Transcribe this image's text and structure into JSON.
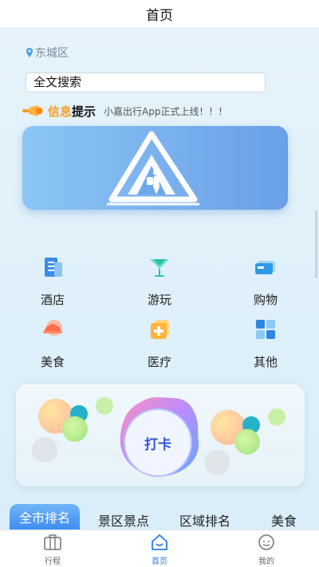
{
  "header": {
    "title": "首页"
  },
  "location": {
    "text": "东城区"
  },
  "search": {
    "text": "全文搜索"
  },
  "notice": {
    "highlight": "信息",
    "label": "提示",
    "message": "小嘉出行App正式上线！！！"
  },
  "categories": [
    {
      "label": "酒店",
      "icon": "hotel-icon"
    },
    {
      "label": "游玩",
      "icon": "cocktail-icon"
    },
    {
      "label": "购物",
      "icon": "shopping-card-icon"
    },
    {
      "label": "美食",
      "icon": "dish-icon"
    },
    {
      "label": "医疗",
      "icon": "medical-icon"
    },
    {
      "label": "其他",
      "icon": "grid-icon"
    }
  ],
  "checkin": {
    "label": "打卡"
  },
  "tabs": [
    {
      "label": "全市排名",
      "active": true
    },
    {
      "label": "景区景点"
    },
    {
      "label": "区域排名"
    },
    {
      "label": "美食"
    }
  ],
  "bottom_nav": [
    {
      "label": "行程",
      "icon": "briefcase-icon"
    },
    {
      "label": "首页",
      "icon": "home-icon",
      "active": true
    },
    {
      "label": "我的",
      "icon": "profile-icon"
    }
  ],
  "colors": {
    "accent": "#3f8df0",
    "highlight": "#f0a23a",
    "banner": "#7ab3ee"
  }
}
